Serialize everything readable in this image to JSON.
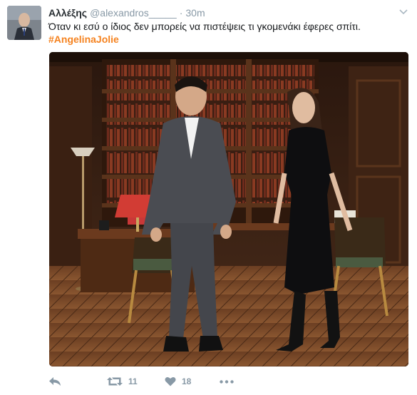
{
  "tweet": {
    "author_name": "Αλλέξης",
    "handle": "@alexandros_____",
    "separator": "·",
    "time": "30m",
    "text": "Όταν κι εσύ ο ίδιος δεν μπορείς να πιστέψεις τι γκομενάκι έφερες σπίτι.",
    "hashtag": "#AngelinaJolie",
    "retweet_count": "11",
    "like_count": "18"
  },
  "colors": {
    "hashtag": "#f5821f",
    "action_gray": "#8899a6",
    "text": "#14171a"
  },
  "icons": [
    "reply-icon",
    "retweet-icon",
    "heart-icon",
    "more-icon",
    "chevron-down-icon"
  ]
}
